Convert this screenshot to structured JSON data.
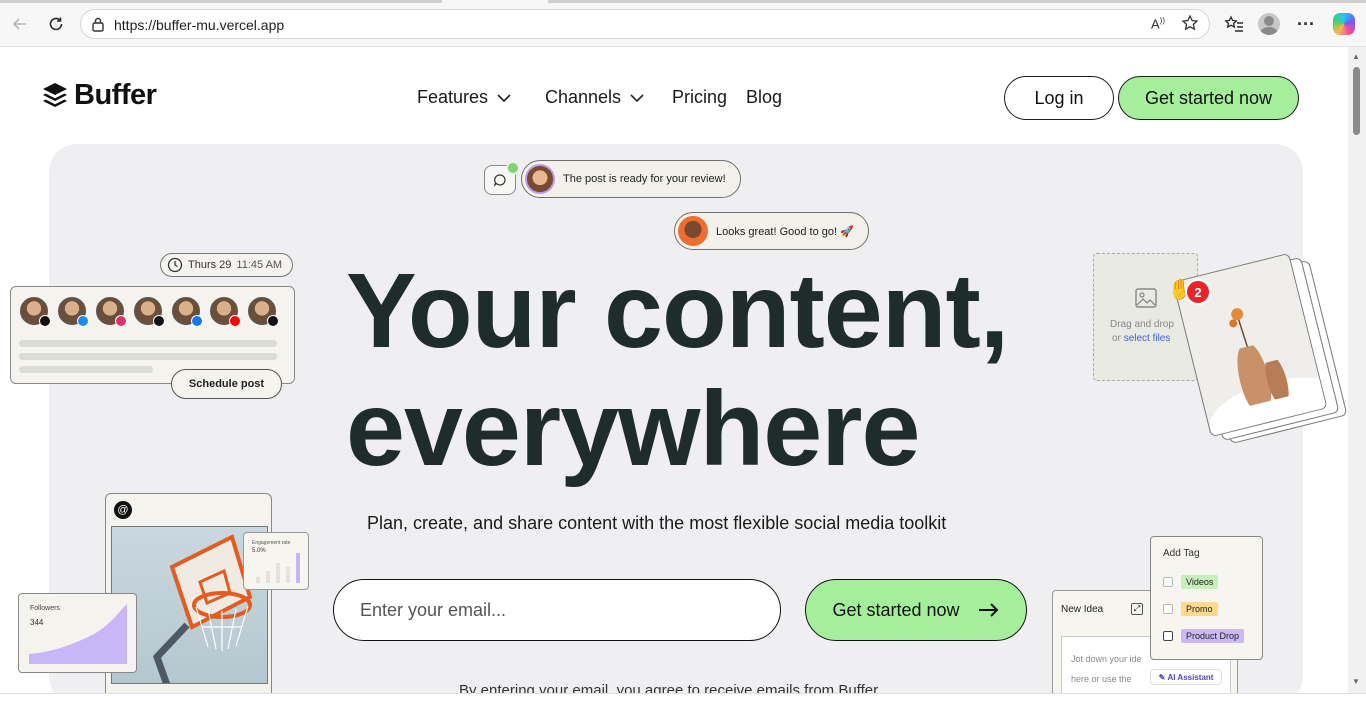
{
  "browser": {
    "url": "https://buffer-mu.vercel.app"
  },
  "nav": {
    "logo_text": "Buffer",
    "items": [
      "Features",
      "Channels",
      "Pricing",
      "Blog"
    ],
    "login_label": "Log in",
    "get_started_label": "Get started now"
  },
  "hero": {
    "headline_line1": "Your content,",
    "headline_line2": "everywhere",
    "subhead": "Plan, create, and share content with the most flexible social media toolkit",
    "email_placeholder": "Enter your email...",
    "cta_label": "Get started now",
    "disclaimer": "By entering your email, you agree to receive emails from Buffer."
  },
  "chat": {
    "bubble1": "The post is ready for your review!",
    "bubble2": "Looks great! Good to go! 🚀"
  },
  "schedule": {
    "day": "Thurs 29",
    "time": "11:45 AM",
    "button_label": "Schedule post",
    "channels": [
      "threads",
      "bluesky",
      "instagram",
      "tiktok",
      "facebook",
      "youtube",
      "x"
    ]
  },
  "stats": {
    "engagement_title": "Engagement rate",
    "engagement_value": "5.0%",
    "followers_title": "Followers",
    "followers_value": "344"
  },
  "upload": {
    "drag_text": "Drag and drop",
    "or_text": "or",
    "select_link": "select files",
    "badge_count": "2"
  },
  "idea": {
    "title": "New Idea",
    "placeholder_line1": "Jot down your ide",
    "placeholder_line2": "here or use the",
    "ai_label": "AI Assistant"
  },
  "tags": {
    "title": "Add Tag",
    "items": [
      {
        "label": "Videos",
        "color": "#c8efb9"
      },
      {
        "label": "Promo",
        "color": "#ffd98a"
      },
      {
        "label": "Product Drop",
        "color": "#cbb8f5"
      }
    ]
  },
  "colors": {
    "accent_green": "#a4ee9c",
    "hero_bg": "#efeff1",
    "headline": "#1e2c2a"
  }
}
